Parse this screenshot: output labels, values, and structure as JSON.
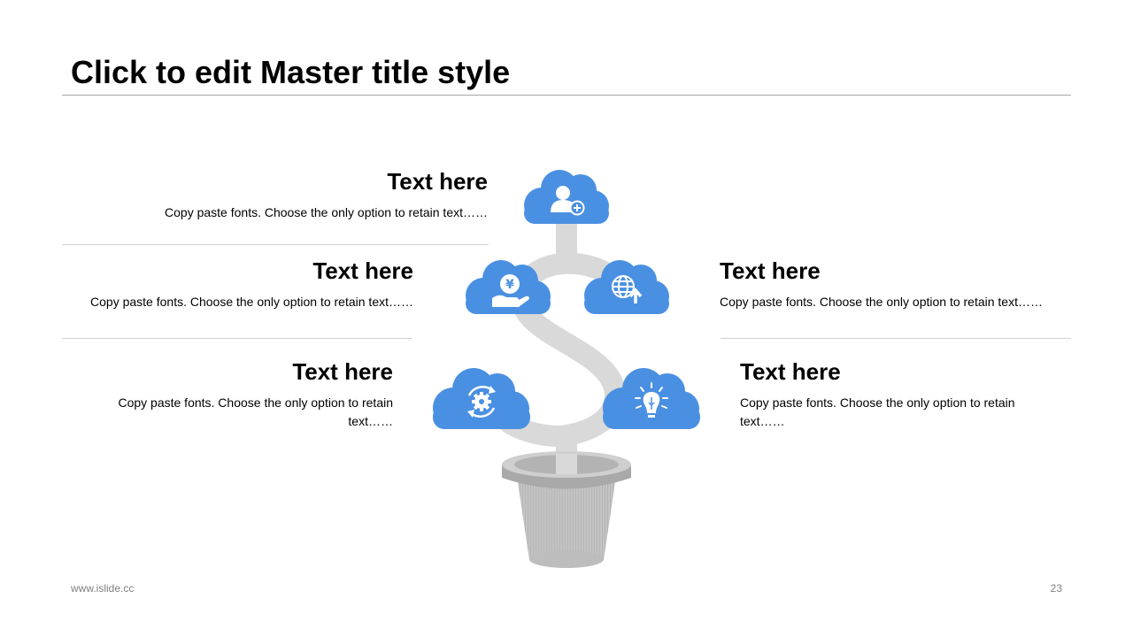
{
  "slide": {
    "title": "Click to edit Master title style",
    "footer_left": "www.islide.cc",
    "page_number": "23"
  },
  "items": [
    {
      "heading": "Text here",
      "body": "Copy paste fonts. Choose the only option to retain text……",
      "icon": "user-add-icon"
    },
    {
      "heading": "Text here",
      "body": "Copy paste fonts. Choose the only option to retain text……",
      "icon": "yen-hand-icon"
    },
    {
      "heading": "Text here",
      "body": "Copy paste fonts. Choose the only option to retain text……",
      "icon": "globe-upload-icon"
    },
    {
      "heading": "Text here",
      "body": "Copy paste fonts. Choose the only option to retain text……",
      "icon": "gear-refresh-icon"
    },
    {
      "heading": "Text here",
      "body": "Copy paste fonts. Choose the only option to retain text……",
      "icon": "lightbulb-icon"
    }
  ],
  "colors": {
    "cloud": "#4a90e2",
    "stem": "#d9d9d9",
    "pot": "#bfbfbf",
    "rule": "#a6a6a6"
  }
}
